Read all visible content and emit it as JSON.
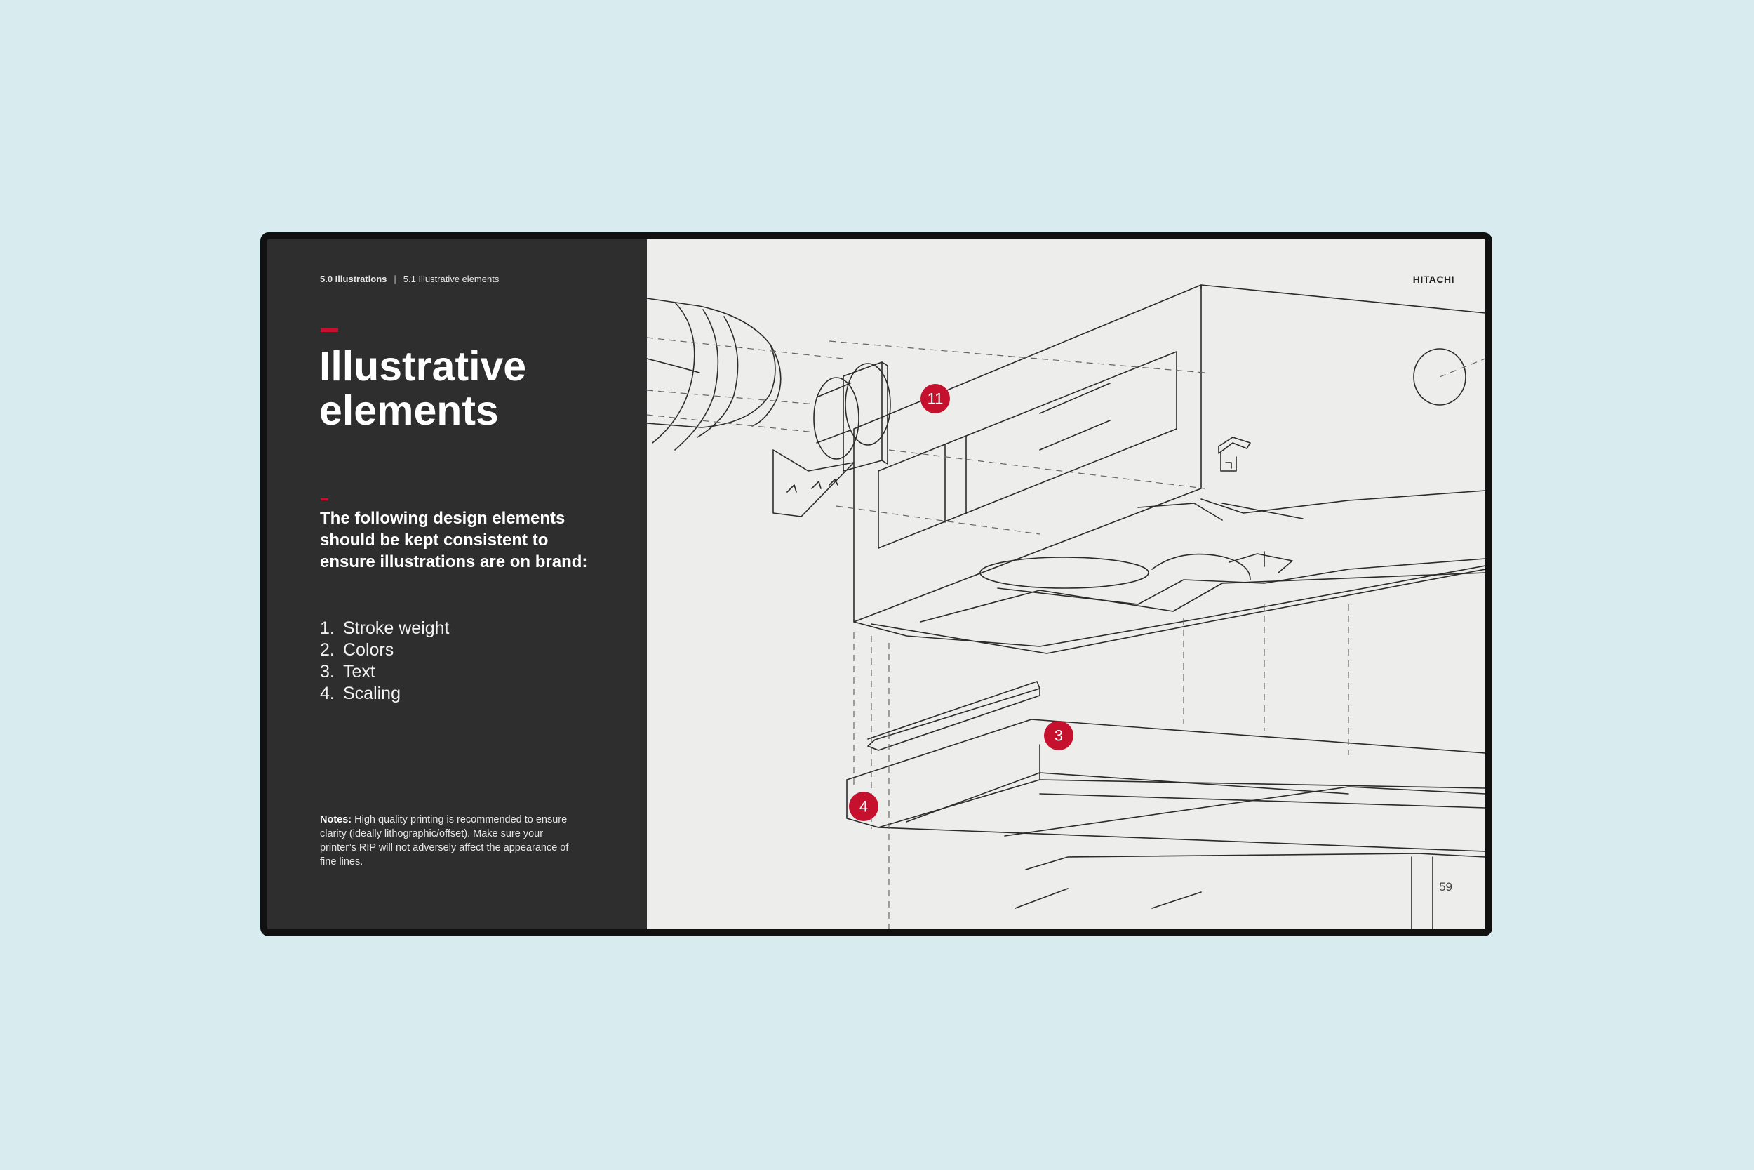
{
  "breadcrumb": {
    "section": "5.0 Illustrations",
    "separator": "|",
    "subsection": "5.1 Illustrative elements"
  },
  "title": {
    "line1": "Illustrative",
    "line2": "elements"
  },
  "intro": "The following design elements should be kept consistent to ensure illustrations are on brand:",
  "list": [
    {
      "num": "1.",
      "label": "Stroke weight"
    },
    {
      "num": "2.",
      "label": "Colors"
    },
    {
      "num": "3.",
      "label": "Text"
    },
    {
      "num": "4.",
      "label": "Scaling"
    }
  ],
  "notes": {
    "label": "Notes:",
    "text": " High quality printing is recommended to ensure clarity (ideally lithographic/offset). Make sure your printer’s RIP will not adversely affect the appearance of fine lines."
  },
  "logo": "HITACHI",
  "page_number": "59",
  "callouts": [
    "11",
    "3",
    "4"
  ],
  "colors": {
    "accent": "#c8102e",
    "dark_panel": "#2e2e2f",
    "light_panel": "#ededec",
    "background": "#d8ebee"
  }
}
